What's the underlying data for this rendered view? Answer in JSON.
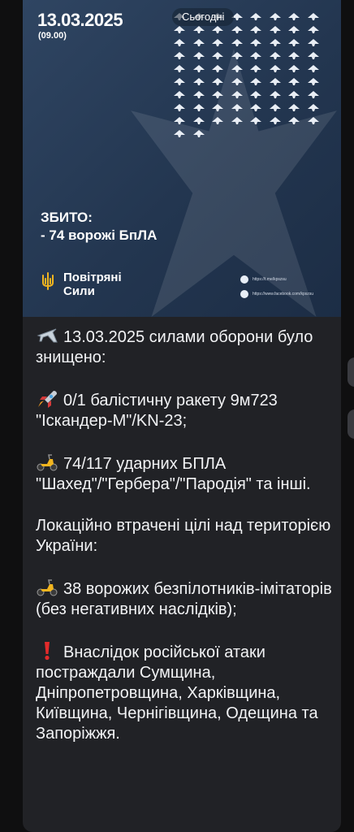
{
  "infographic": {
    "date": "13.03.2025",
    "time": "(09.00)",
    "date_bubble": "Сьогодні",
    "shot_down_title": "ЗБИТО:",
    "shot_down_count": "- 74 ворожі БпЛА",
    "drone_count": 74,
    "brand_line1": "Повітряні",
    "brand_line2": "Сили",
    "social_telegram": "https://t.me/kpszsu",
    "social_facebook": "https://www.facebook.com/kpszsu",
    "colors": {
      "bg": "#2a3f5c",
      "accent": "#f2b51f"
    }
  },
  "message": {
    "p1": "13.03.2025 силами оборони було знищено:",
    "p2": "0/1 балістичну ракету 9м723 \"Іскандер-М\"/KN-23;",
    "p3": "74/117 ударних БПЛА \"Шахед\"/\"Гербера\"/\"Пародія\" та інші.",
    "p4": "Локаційно втрачені цілі над територією України:",
    "p5": "38 ворожих безпілотників-імітаторів (без негативних наслідків);",
    "p6": "Внаслідок російської атаки постраждали Сумщина, Дніпропетровщина, Харківщина, Київщина, Чернігівщина, Одещина та Запоріжжя.",
    "icons": [
      "airplane-icon",
      "rocket-icon",
      "moped-icon",
      "moped-icon",
      "exclamation-icon"
    ]
  }
}
